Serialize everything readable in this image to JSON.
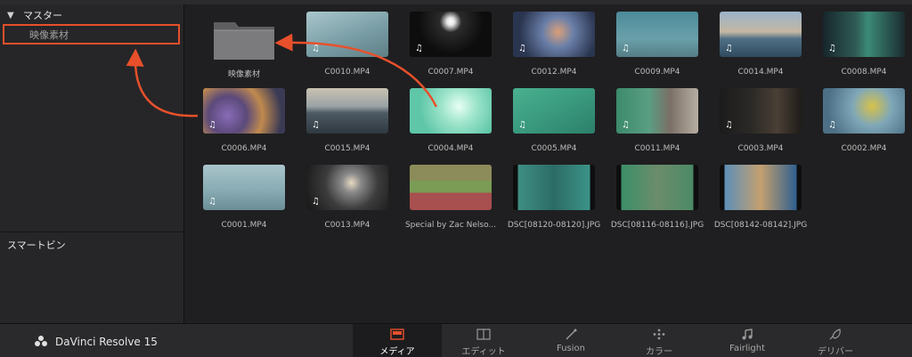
{
  "sidebar": {
    "master_label": "マスター",
    "folder_label": "映像素材",
    "smartbin_label": "スマートビン"
  },
  "media": {
    "folder_label": "映像素材",
    "clips": [
      "C0010.MP4",
      "C0007.MP4",
      "C0012.MP4",
      "C0009.MP4",
      "C0014.MP4",
      "C0008.MP4",
      "C0006.MP4",
      "C0015.MP4",
      "C0004.MP4",
      "C0005.MP4",
      "C0011.MP4",
      "C0003.MP4",
      "C0002.MP4",
      "C0001.MP4",
      "C0013.MP4",
      "Special by Zac Nelso...",
      "DSC[08120-08120].JPG",
      "DSC[08116-08116].JPG",
      "DSC[08142-08142].JPG"
    ],
    "audio_note": "♫"
  },
  "app": {
    "name": "DaVinci Resolve 15"
  },
  "pages": [
    "メディア",
    "エディット",
    "Fusion",
    "カラー",
    "Fairlight",
    "デリバー"
  ],
  "colors": {
    "highlight": "#e7502b",
    "active_page_icon": "#e7502b"
  }
}
